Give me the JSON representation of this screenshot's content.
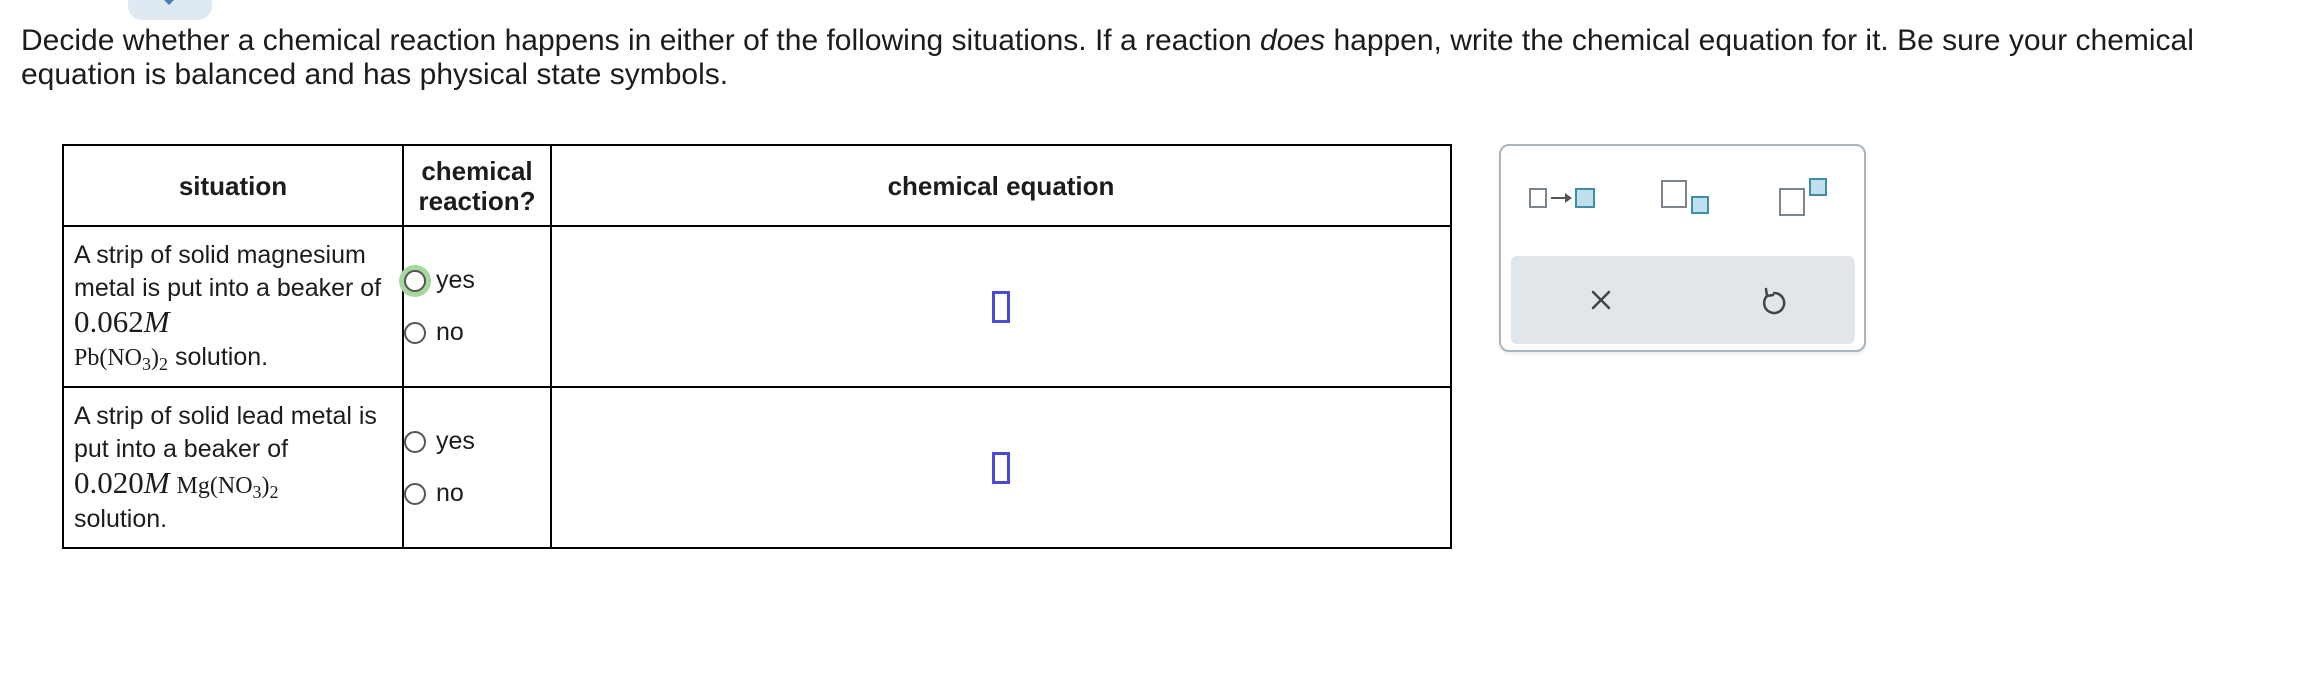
{
  "prompt": {
    "part1": "Decide whether a chemical reaction happens in either of the following situations. If a reaction ",
    "emphasis": "does",
    "part2": " happen, write the chemical equation for it. Be sure your chemical equation is balanced and has physical state symbols."
  },
  "table": {
    "headers": {
      "situation": "situation",
      "reaction_line1": "chemical",
      "reaction_line2": "reaction?",
      "equation": "chemical equation"
    },
    "rows": [
      {
        "situation_text": "A strip of solid magnesium metal is put into a beaker of ",
        "concentration_value": "0.062",
        "concentration_unit": "M",
        "formula_base": "Pb(NO",
        "formula_sub1": "3",
        "formula_close": ")",
        "formula_sub2": "2",
        "situation_tail": " solution.",
        "options": [
          "yes",
          "no"
        ],
        "selected": null
      },
      {
        "situation_text": "A strip of solid lead metal is put into a beaker of ",
        "concentration_value": "0.020",
        "concentration_unit": "M",
        "formula_base": "Mg(NO",
        "formula_sub1": "3",
        "formula_close": ")",
        "formula_sub2": "2",
        "situation_tail": "solution.",
        "options": [
          "yes",
          "no"
        ],
        "selected": null
      }
    ]
  },
  "palette": {
    "buttons": [
      "reaction-arrow-icon",
      "subscript-icon",
      "superscript-icon",
      "clear-icon",
      "undo-icon"
    ]
  },
  "colors": {
    "equation_box": "#4e4ad0",
    "palette_blue": "#3e8ea6",
    "focus_ring": "#a5d89c"
  }
}
